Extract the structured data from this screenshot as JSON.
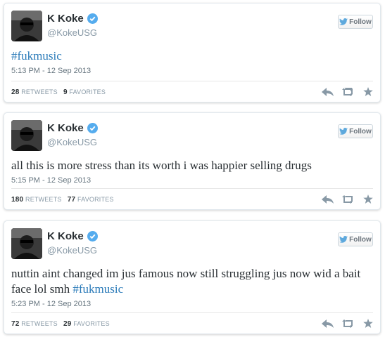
{
  "colors": {
    "hashtag": "#2b7bb9",
    "verified": "#55acee",
    "muted": "#8899a6"
  },
  "follow_label": "Follow",
  "tweets": [
    {
      "name": "K Koke",
      "handle": "@KokeUSG",
      "text_plain": "",
      "hashtag": "#fukmusic",
      "timestamp": "5:13 PM - 12 Sep 2013",
      "retweets": "28",
      "retweets_label": "RETWEETS",
      "favorites": "9",
      "favorites_label": "FAVORITES"
    },
    {
      "name": "K Koke",
      "handle": "@KokeUSG",
      "text_plain": "all this is more stress than its worth i was happier selling drugs",
      "hashtag": "",
      "timestamp": "5:15 PM - 12 Sep 2013",
      "retweets": "180",
      "retweets_label": "RETWEETS",
      "favorites": "77",
      "favorites_label": "FAVORITES"
    },
    {
      "name": "K Koke",
      "handle": "@KokeUSG",
      "text_plain": "nuttin aint changed im jus famous now still struggling jus now wid a bait face lol smh ",
      "hashtag": "#fukmusic",
      "timestamp": "5:23 PM - 12 Sep 2013",
      "retweets": "72",
      "retweets_label": "RETWEETS",
      "favorites": "29",
      "favorites_label": "FAVORITES"
    }
  ]
}
